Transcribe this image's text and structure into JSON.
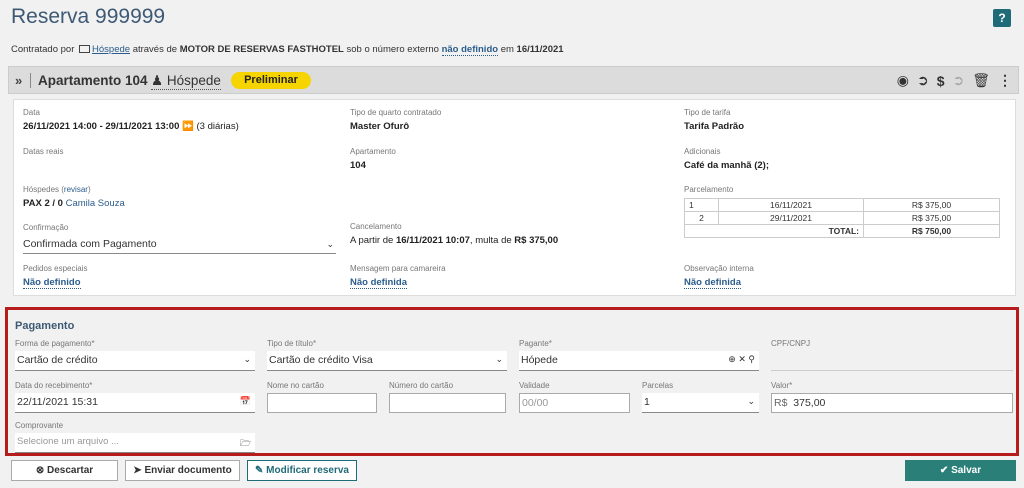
{
  "header": {
    "title": "Reserva 999999",
    "help_label": "?"
  },
  "contract": {
    "prefix": "Contratado por",
    "channel": "Hóspede",
    "through": "através de",
    "engine": "MOTOR DE RESERVAS FASTHOTEL",
    "under": "sob o número externo",
    "external_number": "não definido",
    "on": "em",
    "date": "16/11/2021"
  },
  "apartment_bar": {
    "expand": "»",
    "name": "Apartamento 104",
    "guest_label": "Hóspede",
    "status": "Preliminar",
    "status_color": "#f5d400"
  },
  "details": {
    "data_label": "Data",
    "data_value": "26/11/2021 14:00 - 29/11/2021 13:00",
    "data_extra": "(3 diárias)",
    "tipo_quarto_label": "Tipo de quarto contratado",
    "tipo_quarto_value": "Master Ofurô",
    "tipo_tarifa_label": "Tipo de tarifa",
    "tipo_tarifa_value": "Tarifa Padrão",
    "datas_reais_label": "Datas reais",
    "apartamento_label": "Apartamento",
    "apartamento_value": "104",
    "adicionais_label": "Adicionais",
    "adicionais_value": "Café da manhã (2);",
    "hospedes_label": "Hóspedes (",
    "hospedes_link": "revisar",
    "hospedes_close": ")",
    "pax": "PAX 2 / 0",
    "guest_name": "Camila Souza",
    "parcelamento_label": "Parcelamento",
    "parcelamento": [
      {
        "n": "1",
        "date": "16/11/2021",
        "value": "R$ 375,00"
      },
      {
        "n": "2",
        "date": "29/11/2021",
        "value": "R$ 375,00"
      }
    ],
    "total_label": "TOTAL:",
    "total_value": "R$ 750,00",
    "confirmacao_label": "Confirmação",
    "confirmacao_value": "Confirmada com Pagamento",
    "cancelamento_label": "Cancelamento",
    "cancel_prefix": "A partir de",
    "cancel_date": "16/11/2021 10:07",
    "cancel_mid": ", multa de",
    "cancel_fee": "R$ 375,00",
    "pedidos_label": "Pedidos especiais",
    "pedidos_value": "Não definido",
    "mensagem_label": "Mensagem para camareira",
    "mensagem_value": "Não definida",
    "observacao_label": "Observação interna",
    "observacao_value": "Não definida"
  },
  "payment": {
    "title": "Pagamento",
    "forma_label": "Forma de pagamento*",
    "forma_value": "Cartão de crédito",
    "tipo_label": "Tipo de título*",
    "tipo_value": "Cartão de crédito Visa",
    "pagante_label": "Pagante*",
    "pagante_value": "Hópede",
    "cpf_label": "CPF/CNPJ",
    "data_receb_label": "Data do recebimento*",
    "data_receb_value": "22/11/2021 15:31",
    "nome_cartao_label": "Nome no cartão",
    "numero_cartao_label": "Número do cartão",
    "validade_label": "Validade",
    "validade_placeholder": "00/00",
    "parcelas_label": "Parcelas",
    "parcelas_value": "1",
    "valor_label": "Valor*",
    "valor_prefix": "R$",
    "valor_value": "375,00",
    "comprovante_label": "Comprovante",
    "comprovante_placeholder": "Selecione um arquivo ..."
  },
  "actions": {
    "descartar": "Descartar",
    "enviar": "Enviar documento",
    "modificar": "Modificar reserva",
    "salvar": "Salvar"
  }
}
